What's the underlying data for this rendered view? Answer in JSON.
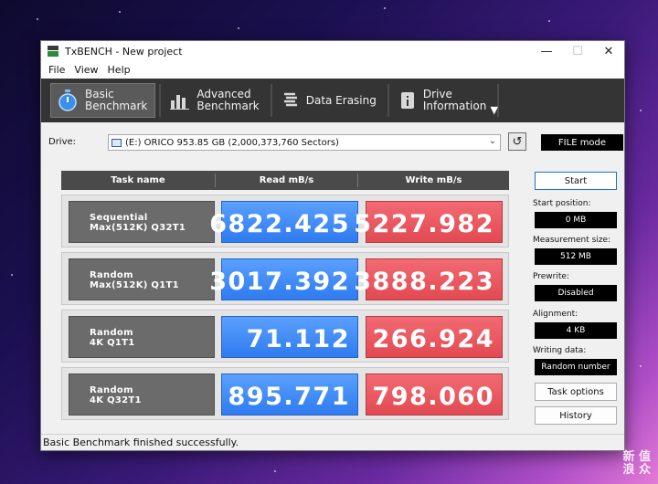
{
  "window": {
    "title": "TxBENCH - New project",
    "controls": {
      "minimize": "—",
      "maximize": "☐",
      "close": "✕"
    }
  },
  "menu": [
    "File",
    "View",
    "Help"
  ],
  "toolbar": {
    "buttons": [
      {
        "line1": "Basic",
        "line2": "Benchmark",
        "icon": "stopwatch-icon",
        "active": true
      },
      {
        "line1": "Advanced",
        "line2": "Benchmark",
        "icon": "bar-chart-icon",
        "active": false
      },
      {
        "line1": "Data Erasing",
        "line2": "",
        "icon": "eraser-icon",
        "active": false
      },
      {
        "line1": "Drive",
        "line2": "Information",
        "icon": "info-icon",
        "active": false
      }
    ],
    "more": "▼"
  },
  "drive": {
    "label": "Drive:",
    "selected": "(E:) ORICO  953.85 GB (2,000,373,760 Sectors)",
    "refresh": "↺",
    "mode": "FILE mode"
  },
  "grid": {
    "headers": {
      "task": "Task name",
      "read": "Read mB/s",
      "write": "Write mB/s"
    },
    "rows": [
      {
        "line1": "Sequential",
        "line2": "Max(512K) Q32T1",
        "read": "6822.425",
        "write": "5227.982"
      },
      {
        "line1": "Random",
        "line2": "Max(512K) Q1T1",
        "read": "3017.392",
        "write": "3888.223"
      },
      {
        "line1": "Random",
        "line2": "4K Q1T1",
        "read": "71.112",
        "write": "266.924"
      },
      {
        "line1": "Random",
        "line2": "4K Q32T1",
        "read": "895.771",
        "write": "798.060"
      }
    ]
  },
  "side": {
    "start": "Start",
    "start_position_label": "Start position:",
    "start_position": "0 MB",
    "measurement_size_label": "Measurement size:",
    "measurement_size": "512 MB",
    "prewrite_label": "Prewrite:",
    "prewrite": "Disabled",
    "alignment_label": "Alignment:",
    "alignment": "4 KB",
    "writing_data_label": "Writing data:",
    "writing_data": "Random number",
    "task_options": "Task options",
    "history": "History"
  },
  "status": "Basic Benchmark finished successfully.",
  "watermark": {
    "line1": "新 值",
    "line2": "浪 众"
  }
}
